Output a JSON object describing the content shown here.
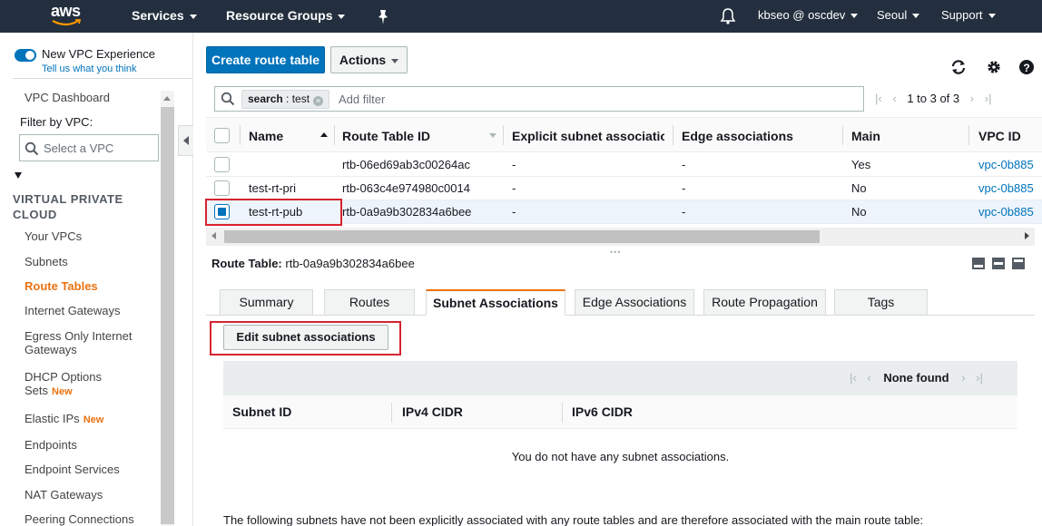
{
  "topnav": {
    "logo": "aws",
    "services": "Services",
    "resource_groups": "Resource Groups",
    "pin_icon": "pin-icon",
    "bell_icon": "bell-icon",
    "account": "kbseo @ oscdev",
    "region": "Seoul",
    "support": "Support"
  },
  "sidebar": {
    "new_vpc_experience": "New VPC Experience",
    "tell_us": "Tell us what you think",
    "dashboard": "VPC Dashboard",
    "filter_label": "Filter by VPC:",
    "select_placeholder": "Select a VPC",
    "section_title_line1": "VIRTUAL PRIVATE",
    "section_title_line2": "CLOUD",
    "items": [
      {
        "label": "Your VPCs"
      },
      {
        "label": "Subnets"
      },
      {
        "label": "Route Tables",
        "active": true
      },
      {
        "label": "Internet Gateways"
      },
      {
        "label": "Egress Only Internet"
      },
      {
        "label": "Gateways"
      },
      {
        "label": "DHCP Options"
      },
      {
        "label": "Sets"
      },
      {
        "label": "Elastic IPs"
      },
      {
        "label": "Endpoints"
      },
      {
        "label": "Endpoint Services"
      },
      {
        "label": "NAT Gateways"
      },
      {
        "label": "Peering Connections"
      }
    ],
    "new_badge": "New"
  },
  "toolbar": {
    "create_label": "Create route table",
    "actions_label": "Actions"
  },
  "search": {
    "token_key": "search",
    "token_sep": " : ",
    "token_value": "test",
    "add_filter": "Add filter"
  },
  "pager": {
    "range": "1 to 3 of 3"
  },
  "table": {
    "columns": [
      "Name",
      "Route Table ID",
      "Explicit subnet association",
      "Edge associations",
      "Main",
      "VPC ID"
    ],
    "rows": [
      {
        "name": "",
        "id": "rtb-06ed69ab3c00264ac",
        "explicit": "-",
        "edge": "-",
        "main": "Yes",
        "vpc": "vpc-0b885",
        "checked": false
      },
      {
        "name": "test-rt-pri",
        "id": "rtb-063c4e974980c0014",
        "explicit": "-",
        "edge": "-",
        "main": "No",
        "vpc": "vpc-0b885",
        "checked": false
      },
      {
        "name": "test-rt-pub",
        "id": "rtb-0a9a9b302834a6bee",
        "explicit": "-",
        "edge": "-",
        "main": "No",
        "vpc": "vpc-0b885",
        "checked": true
      }
    ]
  },
  "detail": {
    "label": "Route Table:",
    "value": "rtb-0a9a9b302834a6bee",
    "tabs": [
      "Summary",
      "Routes",
      "Subnet Associations",
      "Edge Associations",
      "Route Propagation",
      "Tags"
    ],
    "active_tab": "Subnet Associations",
    "edit_button": "Edit subnet associations",
    "sub_pager": "None found",
    "sub_columns": [
      "Subnet ID",
      "IPv4 CIDR",
      "IPv6 CIDR"
    ],
    "empty_message": "You do not have any subnet associations.",
    "footer_note": "The following subnets have not been explicitly associated with any route tables and are therefore associated with the main route table:"
  },
  "colors": {
    "nav_bg": "#232f3e",
    "primary": "#0073bb",
    "accent": "#ec7211",
    "highlight": "#d6232f"
  }
}
